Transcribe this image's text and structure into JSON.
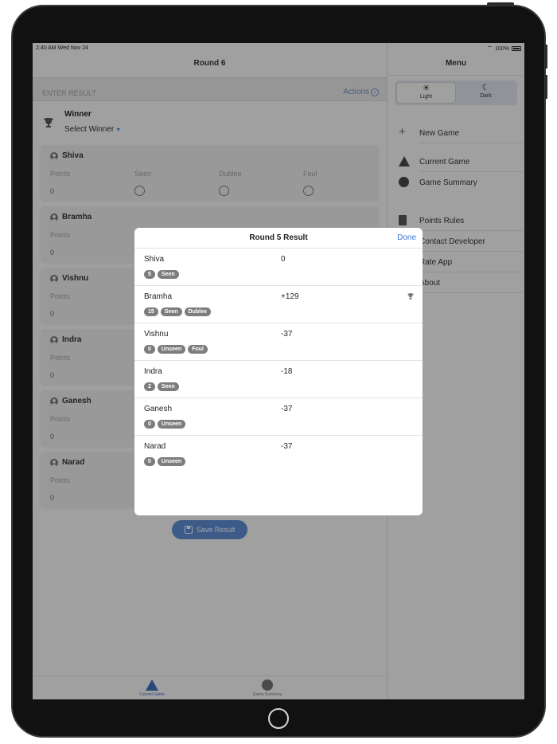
{
  "status": {
    "time": "2:40 AM  Wed Nov 24",
    "battery": "100%"
  },
  "main": {
    "title": "Round 6",
    "enter_result_label": "ENTER RESULT",
    "actions_label": "Actions",
    "winner_title": "Winner",
    "winner_select": "Select Winner",
    "columns": {
      "points": "Points",
      "seen": "Seen",
      "dublee": "Dublee",
      "foul": "Foul"
    },
    "players": [
      {
        "name": "Shiva",
        "points": "0"
      },
      {
        "name": "Bramha",
        "points": "0"
      },
      {
        "name": "Vishnu",
        "points": "0"
      },
      {
        "name": "Indra",
        "points": "0"
      },
      {
        "name": "Ganesh",
        "points": "0"
      },
      {
        "name": "Narad",
        "points": "0"
      }
    ],
    "save_label": "Save Result"
  },
  "tabs": [
    {
      "label": "Current Game",
      "icon": "triangle-icon",
      "color": "#3f6bb3"
    },
    {
      "label": "Game Summary",
      "icon": "circle-icon",
      "color": "#6d6d6d"
    }
  ],
  "menu": {
    "title": "Menu",
    "theme": {
      "light": "Light",
      "dark": "Dark",
      "selected": "Light"
    },
    "items": [
      {
        "label": "New Game",
        "icon": "plus-icon"
      },
      {
        "label": "Current Game",
        "icon": "triangle-icon"
      },
      {
        "label": "Game Summary",
        "icon": "circle-icon"
      },
      {
        "label": "Points Rules",
        "icon": "document-icon"
      },
      {
        "label": "Contact Developer",
        "icon": "mail-icon"
      },
      {
        "label": "Rate App",
        "icon": "star-icon"
      },
      {
        "label": "About",
        "icon": "info-icon"
      }
    ]
  },
  "modal": {
    "title": "Round 5 Result",
    "done_label": "Done",
    "rows": [
      {
        "name": "Shiva",
        "score": "0",
        "tags": [
          "5",
          "Seen"
        ],
        "winner": false
      },
      {
        "name": "Bramha",
        "score": "+129",
        "tags": [
          "15",
          "Seen",
          "Dublee"
        ],
        "winner": true
      },
      {
        "name": "Vishnu",
        "score": "-37",
        "tags": [
          "0",
          "Unseen",
          "Foul"
        ],
        "winner": false
      },
      {
        "name": "Indra",
        "score": "-18",
        "tags": [
          "2",
          "Seen"
        ],
        "winner": false
      },
      {
        "name": "Ganesh",
        "score": "-37",
        "tags": [
          "0",
          "Unseen"
        ],
        "winner": false
      },
      {
        "name": "Narad",
        "score": "-37",
        "tags": [
          "0",
          "Unseen"
        ],
        "winner": false
      }
    ]
  },
  "colors": {
    "accent": "#3d7ad6",
    "tag_bg": "#7d7d7d",
    "save_button": "#5b87c9"
  }
}
